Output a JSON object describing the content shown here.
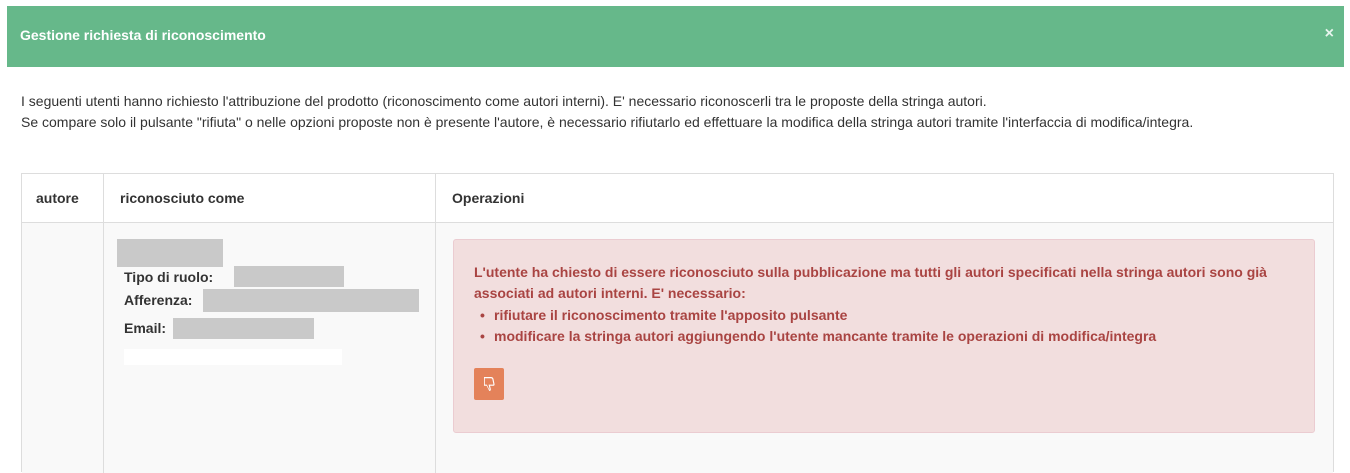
{
  "modal": {
    "title": "Gestione richiesta di riconoscimento",
    "close_label": "×",
    "header_color": "#66b88a"
  },
  "intro": {
    "line1": "I seguenti utenti hanno richiesto l'attribuzione del prodotto (riconoscimento come autori interni). E' necessario riconoscerli tra le proposte della stringa autori.",
    "line2": "Se compare solo il pulsante \"rifiuta\" o nelle opzioni proposte non è presente l'autore, è necessario rifiutarlo ed effettuare la modifica della stringa autori tramite l'interfaccia di modifica/integra."
  },
  "table": {
    "headers": [
      "autore",
      "riconosciuto come",
      "Operazioni"
    ],
    "row": {
      "labels": {
        "tipo_ruolo": "Tipo di ruolo:",
        "afferenza": "Afferenza:",
        "email": "Email:"
      },
      "alert": {
        "message": "L'utente ha chiesto di essere riconosciuto sulla pubblicazione ma tutti gli autori specificati nella stringa autori sono già associati ad autori interni. E' necessario:",
        "items": [
          "rifiutare il riconoscimento tramite l'apposito pulsante",
          "modificare la stringa autori aggiungendo l'utente mancante tramite le operazioni di modifica/integra"
        ],
        "reject_icon": "thumbs-down-icon",
        "reject_color": "#e4825a"
      }
    }
  }
}
